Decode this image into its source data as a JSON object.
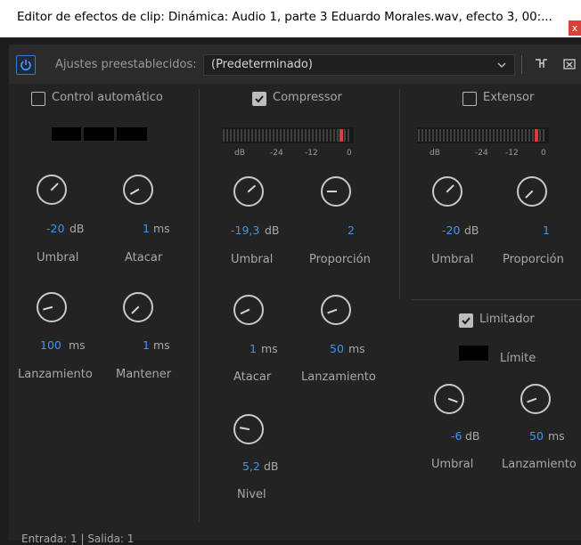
{
  "window": {
    "title": "Editor de efectos de clip: Dinámica: Audio 1, parte 3 Eduardo Morales.wav, efecto 3, 00:...",
    "close_glyph": "x"
  },
  "toolbar": {
    "presets_label": "Ajustes preestablecidos:",
    "preset_value": "(Predeterminado)"
  },
  "auto_control": {
    "label": "Control automático",
    "checked": false,
    "knobs": [
      {
        "value": "-20",
        "unit": "dB",
        "label": "Umbral"
      },
      {
        "value": "1",
        "unit": "ms",
        "label": "Atacar"
      },
      {
        "value": "100",
        "unit": "ms",
        "label": "Lanzamiento"
      },
      {
        "value": "1",
        "unit": "ms",
        "label": "Mantener"
      }
    ]
  },
  "compressor": {
    "label": "Compressor",
    "checked": true,
    "meter_scale": [
      "dB",
      "-24",
      "-12",
      "0"
    ],
    "knobs": [
      {
        "value": "-19,3",
        "unit": "dB",
        "label": "Umbral"
      },
      {
        "value": "2",
        "unit": "",
        "label": "Proporción"
      },
      {
        "value": "1",
        "unit": "ms",
        "label": "Atacar"
      },
      {
        "value": "50",
        "unit": "ms",
        "label": "Lanzamiento"
      },
      {
        "value": "5,2",
        "unit": "dB",
        "label": "Nivel"
      }
    ]
  },
  "expander": {
    "label": "Extensor",
    "checked": false,
    "meter_scale": [
      "dB",
      "-24",
      "-12",
      "0"
    ],
    "knobs": [
      {
        "value": "-20",
        "unit": "dB",
        "label": "Umbral"
      },
      {
        "value": "1",
        "unit": "",
        "label": "Proporción"
      }
    ]
  },
  "limiter": {
    "label": "Limitador",
    "checked": true,
    "limit_label": "Límite",
    "knobs": [
      {
        "value": "-6",
        "unit": "dB",
        "label": "Umbral"
      },
      {
        "value": "50",
        "unit": "ms",
        "label": "Lanzamiento"
      }
    ]
  },
  "status": "Entrada: 1 | Salida: 1",
  "colors": {
    "accent_value": "#3f96ee",
    "power_border": "#3a78c9",
    "meter_red": "#e03b3b",
    "close_red": "#d9413a"
  },
  "icons": [
    "power-icon",
    "chevron-down-icon",
    "routing-icon",
    "close-panel-icon",
    "checkmark-icon",
    "knob-icon"
  ]
}
